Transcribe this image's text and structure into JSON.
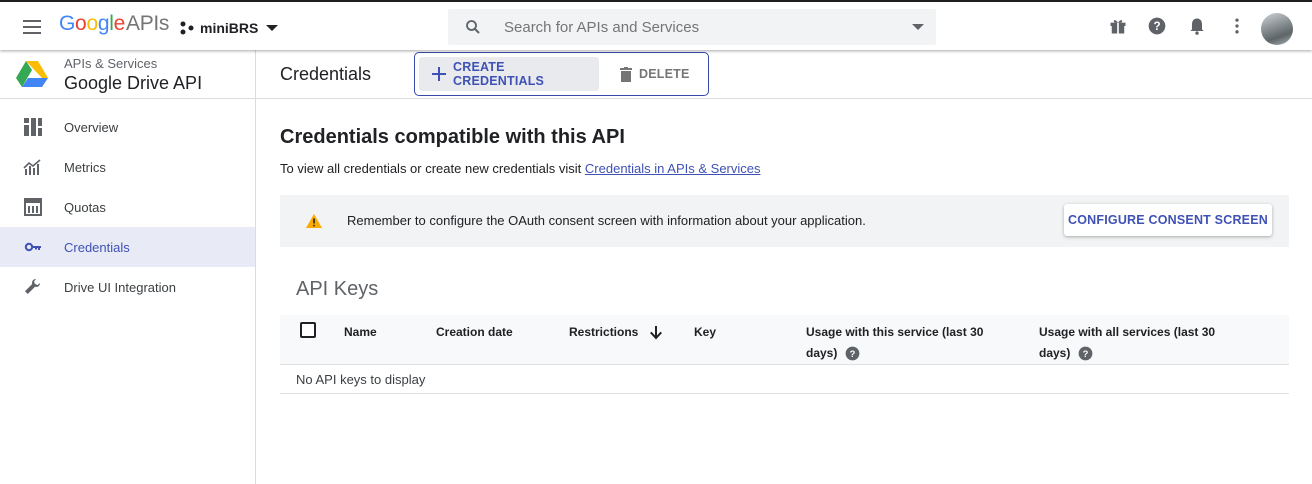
{
  "topbar": {
    "logo_google": "Google",
    "logo_apis": "APIs",
    "project_name": "miniBRS",
    "search_placeholder": "Search for APIs and Services",
    "icons": [
      "menu-icon",
      "gift-icon",
      "help-icon",
      "notifications-icon",
      "more-vert-icon",
      "avatar"
    ]
  },
  "sidebar": {
    "supertitle": "APIs & Services",
    "api_name": "Google Drive API",
    "items": [
      {
        "label": "Overview",
        "icon": "overview-icon"
      },
      {
        "label": "Metrics",
        "icon": "metrics-icon"
      },
      {
        "label": "Quotas",
        "icon": "quotas-icon"
      },
      {
        "label": "Credentials",
        "icon": "key-icon",
        "active": true
      },
      {
        "label": "Drive UI Integration",
        "icon": "wrench-icon"
      }
    ]
  },
  "main": {
    "title": "Credentials",
    "create_button": "CREATE CREDENTIALS",
    "delete_button": "DELETE",
    "heading": "Credentials compatible with this API",
    "info_text": "To view all credentials or create new credentials visit ",
    "info_link": "Credentials in APIs & Services",
    "banner_text": "Remember to configure the OAuth consent screen with information about your application.",
    "banner_button": "CONFIGURE CONSENT SCREEN",
    "section_title": "API Keys",
    "table": {
      "columns": [
        "Name",
        "Creation date",
        "Restrictions",
        "Key",
        "Usage with this service (last 30 days)",
        "Usage with all services (last 30 days)"
      ],
      "col_usage_service_line1": "Usage with this service (last 30",
      "col_usage_service_line2": "days)",
      "col_usage_all_line1": "Usage with all services (last 30",
      "col_usage_all_line2": "days)",
      "empty_text": "No API keys to display"
    }
  },
  "colors": {
    "accent": "#3f51b5",
    "active_bg": "#e8eaf6",
    "banner_bg": "#f1f3f4",
    "warning": "#f9ab00"
  }
}
